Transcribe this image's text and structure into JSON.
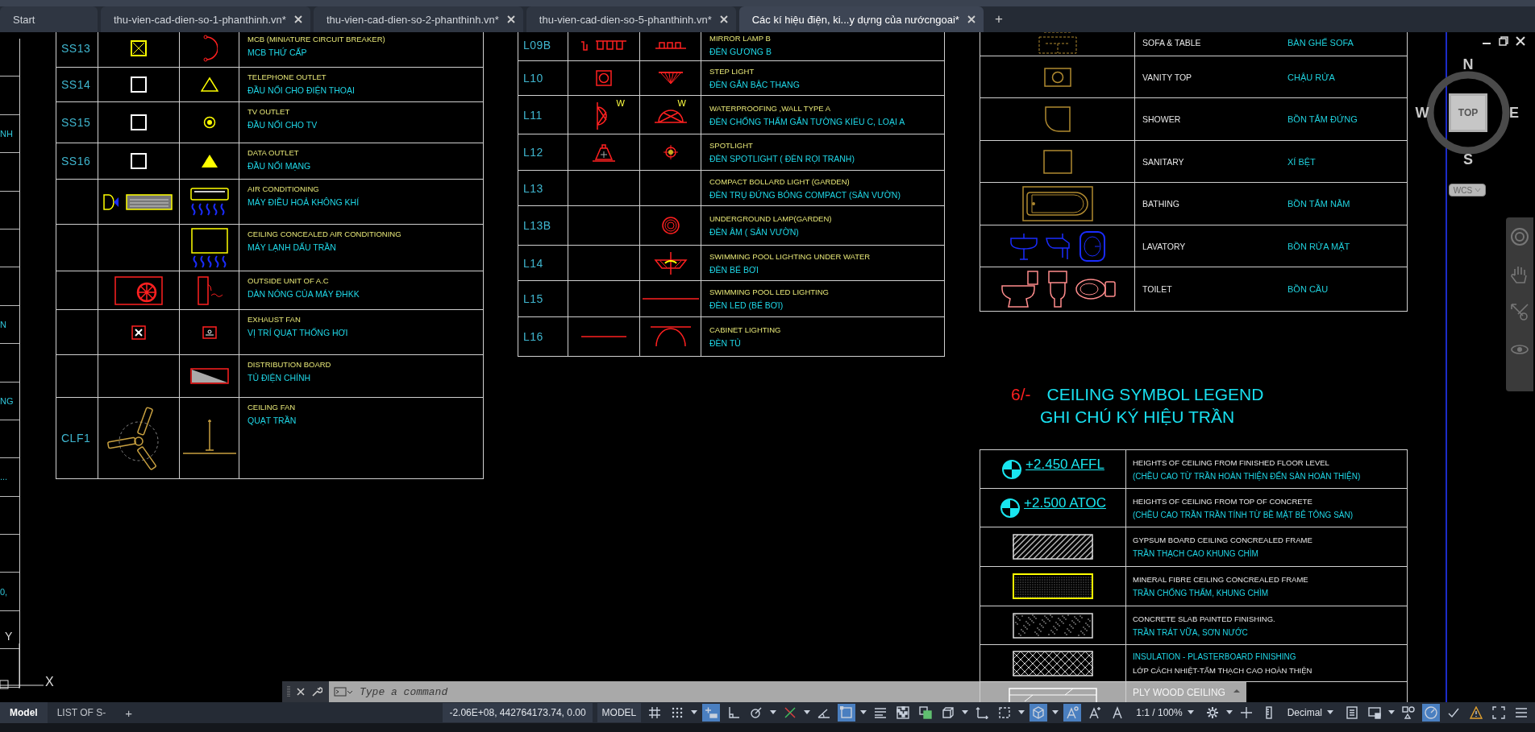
{
  "tabs": [
    {
      "label": "Start",
      "selected": false,
      "closable": false
    },
    {
      "label": "thu-vien-cad-dien-so-1-phanthinh.vn*",
      "selected": false,
      "closable": true
    },
    {
      "label": "thu-vien-cad-dien-so-2-phanthinh.vn*",
      "selected": false,
      "closable": true
    },
    {
      "label": "thu-vien-cad-dien-so-5-phanthinh.vn*",
      "selected": false,
      "closable": true
    },
    {
      "label": "Các kí hiệu điện, ki...y dựng của nướcngoai*",
      "selected": true,
      "closable": true
    }
  ],
  "tab_add": "+",
  "edge_labels": [
    "NH",
    "N",
    "NG",
    "...",
    "0,"
  ],
  "electrical_table": {
    "rows": [
      {
        "code": "SS13",
        "en": "MCB (MINIATURE CIRCUIT BREAKER)",
        "vi": "MCB THỨ CẤP"
      },
      {
        "code": "SS14",
        "en": "TELEPHONE OUTLET",
        "vi": "ĐẦU NỐI CHO ĐIỆN THOẠI"
      },
      {
        "code": "SS15",
        "en": "TV OUTLET",
        "vi": "ĐẦU NỐI CHO TV"
      },
      {
        "code": "SS16",
        "en": "DATA OUTLET",
        "vi": "ĐẦU NỐI MẠNG"
      },
      {
        "en": "AIR CONDITIONING",
        "vi": "MÁY ĐIỀU HOẢ KHÔNG KHÍ"
      },
      {
        "en": "CEILING CONCEALED AIR CONDITIONING",
        "vi": "MÁY LẠNH DẤU TRẦN"
      },
      {
        "en": "OUTSIDE UNIT OF A.C",
        "vi": "DÀN NÓNG CỦA MÁY ĐHKK"
      },
      {
        "en": "EXHAUST FAN",
        "vi": "VỊ TRÍ QUẠT THỐNG HƠI"
      },
      {
        "en": "DISTRIBUTION BOARD",
        "vi": "TỦ ĐIỆN CHÍNH"
      },
      {
        "code": "CLF1",
        "en": "CEILING FAN",
        "vi": "QUẠT TRẦN"
      }
    ]
  },
  "lighting_table": {
    "rows": [
      {
        "code": "L09B",
        "en": "MIRROR LAMP B",
        "vi": "ĐÈN GƯƠNG B"
      },
      {
        "code": "L10",
        "en": "STEP LIGHT",
        "vi": "ĐÈN GẮN BẬC THANG"
      },
      {
        "code": "L11",
        "en": "WATERPROOFING ,WALL TYPE A",
        "vi": "ĐÈN CHỐNG THẤM GẮN TƯỜNG KIỂU C, LOẠI A",
        "marks": [
          "W",
          "W"
        ]
      },
      {
        "code": "L12",
        "en": "SPOTLIGHT",
        "vi": "ĐÈN SPOTLIGHT ( ĐÈN RỌI TRANH)"
      },
      {
        "code": "L13",
        "en": "COMPACT BOLLARD LIGHT (GARDEN)",
        "vi": "ĐÈN TRỤ ĐỨNG BÓNG COMPACT (SÂN VƯỜN)"
      },
      {
        "code": "L13B",
        "en": "UNDERGROUND LAMP(GARDEN)",
        "vi": "ĐÈN ÂM ( SÂN VƯỜN)"
      },
      {
        "code": "L14",
        "en": "SWIMMING POOL LIGHTING UNDER WATER",
        "vi": "ĐÈN BỂ BƠI"
      },
      {
        "code": "L15",
        "en": "SWIMMING POOL LED LIGHTING",
        "vi": "ĐÈN LED (BỂ BƠI)"
      },
      {
        "code": "L16",
        "en": "CABINET LIGHTING",
        "vi": "ĐÈN TỦ"
      }
    ]
  },
  "furniture_table": {
    "rows": [
      {
        "en": "SOFA & TABLE",
        "vi": "BÀN GHẾ SOFA"
      },
      {
        "en": "VANITY TOP",
        "vi": "CHẬU RỬA"
      },
      {
        "en": "SHOWER",
        "vi": "BỒN TẮM ĐỨNG"
      },
      {
        "en": "SANITARY",
        "vi": "XÍ BỆT"
      },
      {
        "en": "BATHING",
        "vi": "BỒN TẮM NẰM"
      },
      {
        "en": "LAVATORY",
        "vi": "BỒN RỬA MẶT"
      },
      {
        "en": "TOILET",
        "vi": "BỒN CẦU"
      }
    ]
  },
  "ceiling_legend": {
    "number": "6/-",
    "title": "CEILING SYMBOL LEGEND",
    "subtitle": "GHI CHÚ KÝ HIỆU TRẦN",
    "rows": [
      {
        "kind": "level",
        "label": "+2.450 AFFL",
        "lines": [
          {
            "text": "HEIGHTS OF CEILING FROM FINISHED FLOOR LEVEL",
            "accent": false
          },
          {
            "text": "(CHỀU CAO TỪ TRẦN HOÀN THIỆN ĐẾN SÀN HOÀN THIỆN)",
            "accent": true
          }
        ]
      },
      {
        "kind": "level",
        "label": "+2.500 ATOC",
        "lines": [
          {
            "text": "HEIGHTS OF CEILING FROM TOP OF CONCRETE",
            "accent": false
          },
          {
            "text": "(CHỀU CAO TRẦN TRẦN TÍNH TỪ BỀ MẶT BÊ TÔNG SÀN)",
            "accent": true
          }
        ]
      },
      {
        "kind": "diagonal",
        "lines": [
          {
            "text": "GYPSUM BOARD CEILING CONCREALED FRAME",
            "accent": false
          },
          {
            "text": "TRẦN THẠCH CAO KHUNG CHÌM",
            "accent": true
          }
        ]
      },
      {
        "kind": "dotted",
        "lines": [
          {
            "text": "MINERAL FIBRE CEILING CONCREALED FRAME",
            "accent": false
          },
          {
            "text": "TRẦN CHỐNG THẤM, KHUNG CHÌM",
            "accent": true
          }
        ]
      },
      {
        "kind": "speckled",
        "lines": [
          {
            "text": "CONCRETE SLAB PAINTED FINISHING.",
            "accent": false
          },
          {
            "text": "TRẦN TRÁT VỮA, SƠN NƯỚC",
            "accent": true
          }
        ]
      },
      {
        "kind": "crossed",
        "lines": [
          {
            "text": "INSULATION - PLASTERBOARD FINISHING",
            "accent": true
          },
          {
            "text": "LỚP CÁCH NHIỆT-TẤM THẠCH CAO HOÀN THIỆN",
            "accent": false
          }
        ]
      },
      {
        "kind": "plywood",
        "lines": [
          {
            "text": "PLY WOOD CEILING",
            "accent": false
          }
        ]
      }
    ]
  },
  "viewcube": {
    "north": "N",
    "east": "E",
    "south": "S",
    "west": "W",
    "face": "TOP",
    "coordinate_system": "WCS"
  },
  "ucs": {
    "y": "Y",
    "x": "X"
  },
  "command_line": {
    "placeholder": "Type a command"
  },
  "layout_tabs": [
    {
      "label": "Model",
      "selected": true
    },
    {
      "label": "LIST OF S-",
      "selected": false
    }
  ],
  "layout_add": "+",
  "status_bar": {
    "items": [
      {
        "kind": "readout",
        "text": "-2.06E+08, 442764173.74, 0.00"
      },
      {
        "kind": "label",
        "text": "MODEL"
      },
      {
        "kind": "tool",
        "on": false
      },
      {
        "kind": "tool",
        "on": false
      },
      {
        "kind": "tool",
        "on": true
      },
      {
        "kind": "tool",
        "on": false
      },
      {
        "kind": "tool",
        "on": false
      },
      {
        "kind": "tool",
        "on": false
      },
      {
        "kind": "tool",
        "on": false
      },
      {
        "kind": "tool",
        "on": true
      },
      {
        "kind": "tool",
        "on": false
      },
      {
        "kind": "tool",
        "on": false
      },
      {
        "kind": "tool",
        "on": false
      },
      {
        "kind": "tool",
        "on": false
      },
      {
        "kind": "tool",
        "on": false
      },
      {
        "kind": "tool",
        "on": false
      },
      {
        "kind": "tool",
        "on": true
      },
      {
        "kind": "tool",
        "on": true
      },
      {
        "kind": "tool",
        "on": false
      },
      {
        "kind": "tool",
        "on": false
      },
      {
        "kind": "dropdown",
        "text": "1:1 / 100%"
      },
      {
        "kind": "tool",
        "on": false
      },
      {
        "kind": "tool",
        "on": false
      },
      {
        "kind": "tool",
        "on": false
      },
      {
        "kind": "dropdown",
        "text": "Decimal"
      },
      {
        "kind": "tool",
        "on": false
      },
      {
        "kind": "tool",
        "on": false
      },
      {
        "kind": "tool",
        "on": false
      },
      {
        "kind": "tool",
        "on": true
      },
      {
        "kind": "tool",
        "on": false
      },
      {
        "kind": "tool",
        "on": false
      },
      {
        "kind": "tool",
        "on": false
      },
      {
        "kind": "tool",
        "on": false
      }
    ]
  }
}
